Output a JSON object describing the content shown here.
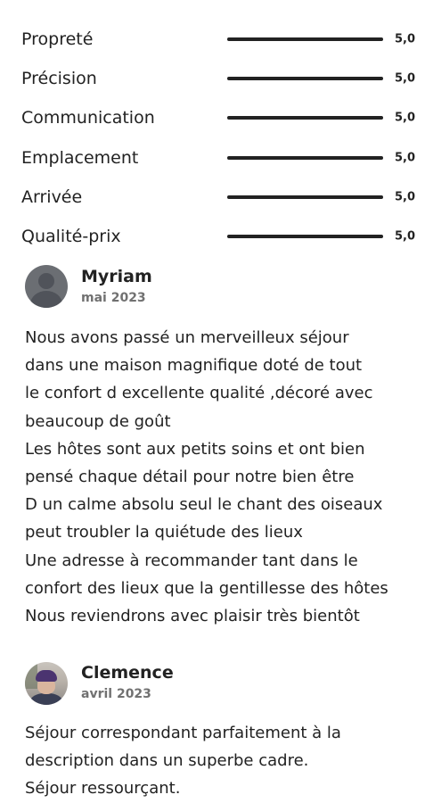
{
  "ratings": [
    {
      "label": "Propreté",
      "value": "5,0",
      "fraction": 1.0
    },
    {
      "label": "Précision",
      "value": "5,0",
      "fraction": 1.0
    },
    {
      "label": "Communication",
      "value": "5,0",
      "fraction": 1.0
    },
    {
      "label": "Emplacement",
      "value": "5,0",
      "fraction": 1.0
    },
    {
      "label": "Arrivée",
      "value": "5,0",
      "fraction": 1.0
    },
    {
      "label": "Qualité-prix",
      "value": "5,0",
      "fraction": 1.0
    }
  ],
  "reviews": [
    {
      "name": "Myriam",
      "date": "mai 2023",
      "avatar": "default-user-icon",
      "lines": [
        "Nous avons passé un merveilleux séjour",
        "dans une maison magnifique doté de tout",
        "le confort d excellente qualité ,décoré avec",
        "beaucoup de goût",
        "Les hôtes sont aux petits soins et ont bien",
        "pensé chaque détail pour notre bien être",
        "D un calme absolu seul le chant des oiseaux",
        "peut troubler la quiétude des lieux",
        "Une adresse à recommander tant dans le",
        "confort des lieux que la gentillesse des hôtes",
        "Nous reviendrons avec plaisir très bientôt"
      ]
    },
    {
      "name": "Clemence",
      "date": "avril 2023",
      "avatar": "user-photo",
      "lines": [
        "Séjour correspondant parfaitement à la",
        "description dans un superbe cadre.",
        "Séjour ressourçant."
      ]
    }
  ],
  "colors": {
    "text": "#222222",
    "muted": "#717171",
    "bar_fill": "#222222",
    "bar_track": "#dddddd"
  }
}
